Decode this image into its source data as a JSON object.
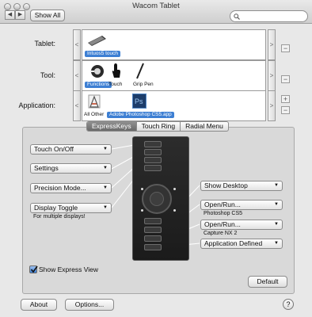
{
  "window": {
    "title": "Wacom Tablet"
  },
  "toolbar": {
    "back": "◀",
    "forward": "▶",
    "show_all": "Show All",
    "search_placeholder": ""
  },
  "rows": {
    "tablet": {
      "label": "Tablet:",
      "items": [
        "Intuos5 touch"
      ]
    },
    "tool": {
      "label": "Tool:",
      "items": [
        "Functions",
        "Touch",
        "Grip Pen"
      ]
    },
    "application": {
      "label": "Application:",
      "items": [
        "All Other",
        "Adobe Photoshop CS5.app"
      ]
    }
  },
  "strip_controls": {
    "left_arrow": "<",
    "right_arrow": ">",
    "minus": "−",
    "plus": "+"
  },
  "tabs": [
    "ExpressKeys",
    "Touch Ring",
    "Radial Menu"
  ],
  "left_keys": [
    {
      "value": "Touch On/Off"
    },
    {
      "value": "Settings"
    },
    {
      "value": "Precision Mode..."
    },
    {
      "value": "Display Toggle",
      "note": "For multiple displays!"
    }
  ],
  "right_keys": [
    {
      "value": "Show Desktop"
    },
    {
      "value": "Open/Run...",
      "note": "Photoshop CS5"
    },
    {
      "value": "Open/Run...",
      "note": "Capture NX 2"
    },
    {
      "value": "Application Defined"
    }
  ],
  "show_express_view": {
    "label": "Show Express View",
    "checked": true
  },
  "buttons": {
    "default": "Default",
    "about": "About",
    "options": "Options...",
    "help": "?"
  },
  "colors": {
    "selection": "#3d7fd3",
    "tablet_body": "#222222"
  }
}
